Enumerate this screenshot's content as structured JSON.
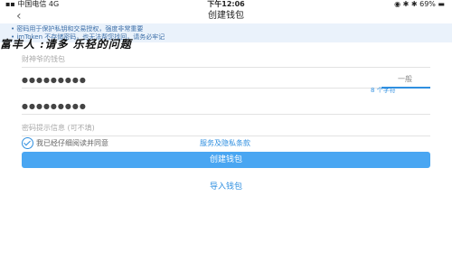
{
  "status_bar": {
    "carrier": "▪▪ 中国电信  4G",
    "time": "下午12:06",
    "indicators": "◉ ✱ ✱ 69% ▬"
  },
  "nav": {
    "back_icon": "‹",
    "title": "创建钱包"
  },
  "tips": {
    "line1": "• 密码用于保护私钥和交易授权，强度非常重要",
    "line2": "• imToken 不存储密码，也无法帮您找回，请务必牢记"
  },
  "overlay_title": "富丰人 :请多 乐轻的问题",
  "form": {
    "wallet_name_placeholder": "财神爷的钱包",
    "password_mask": "●●●●●●●●●",
    "strength_label": "一般",
    "strength_hint": "8 个字符",
    "repeat_password_mask": "●●●●●●●●●",
    "hint_placeholder": "密码提示信息 (可不填)"
  },
  "agreement": {
    "text": "我已经仔细阅读并同意",
    "link": "服务及隐私条款"
  },
  "buttons": {
    "create": "创建钱包",
    "import": "导入钱包"
  },
  "colors": {
    "accent": "#2f8fe0",
    "button": "#49a6f2",
    "tip_bg": "#eaf2fb"
  }
}
